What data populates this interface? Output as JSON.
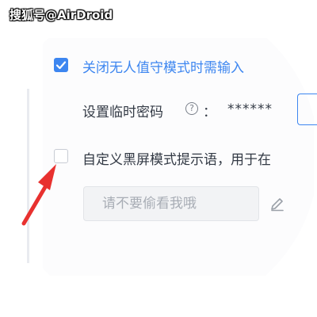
{
  "watermark": "搜狐号@AirDroid",
  "settings": {
    "require_input_label": "关闭无人值守模式时需输入",
    "require_input_checked": true,
    "temp_password_label": "设置临时密码",
    "help_symbol": "?",
    "colon": "：",
    "temp_password_value": "******",
    "custom_prompt_label": "自定义黑屏模式提示语，用于在",
    "custom_prompt_checked": false,
    "custom_prompt_input_value": "请不要偷看我哦"
  },
  "icons": {
    "checkbox_checked": "check-icon",
    "help": "question-circle-icon",
    "edit": "pencil-icon",
    "annotation": "red-arrow-icon"
  },
  "colors": {
    "accent": "#3d86f0",
    "text": "#333a45",
    "placeholder": "#a8adb5",
    "arrow": "#e8312f"
  }
}
